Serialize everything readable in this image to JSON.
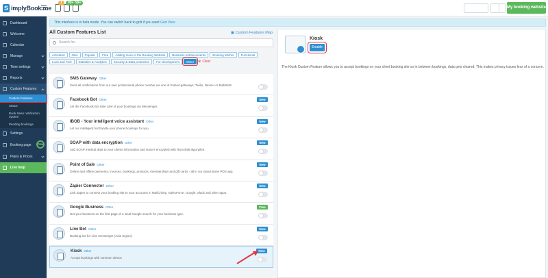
{
  "app": {
    "logo_mark": "S",
    "logo_text": "implyBook.me"
  },
  "topbar": {
    "badges": [
      "1",
      "99+",
      "99+"
    ],
    "user_label": "",
    "my_booking_label": "My booking website"
  },
  "sidebar": {
    "items": [
      {
        "label": "Dashboard",
        "icon": "dashboard-icon"
      },
      {
        "label": "Welcome",
        "icon": "welcome-icon"
      },
      {
        "label": "Calendar",
        "icon": "calendar-icon"
      },
      {
        "label": "Manage",
        "icon": "manage-icon"
      },
      {
        "label": "Time settings",
        "icon": "clock-icon"
      },
      {
        "label": "Reports",
        "icon": "reports-icon"
      },
      {
        "label": "Custom Features",
        "icon": "puzzle-icon"
      }
    ],
    "subitems": [
      "Custom Features",
      "Status",
      "Book Seen notification system",
      "Pending bookings"
    ],
    "items2": [
      {
        "label": "Settings",
        "icon": "gear-icon"
      },
      {
        "label": "Booking page",
        "icon": "booking-page-icon",
        "progress_label": "75%"
      },
      {
        "label": "Plans & Prices",
        "icon": "plans-icon"
      },
      {
        "label": "Live help",
        "icon": "help-icon"
      }
    ]
  },
  "banner": {
    "text": "This interface is in beta mode. You can switch back to grid if you want ",
    "link": "Grid View"
  },
  "list_panel": {
    "title": "All Custom Features List",
    "map_link": "Custom Features Map",
    "search_placeholder": "Search for...",
    "tags": [
      "Activated",
      "New",
      "Popular",
      "Free",
      "Adding more to the Booking Website",
      "Business enhancements",
      "Booking fetcher",
      "Functional",
      "Look and Feel",
      "Statistics & Analytics",
      "Security & Data protection",
      "For development",
      "Other"
    ],
    "selected_tag": "Other",
    "clear_label": "Clear",
    "features": [
      {
        "name": "SMS Gateway",
        "cat": "Other",
        "desc": "Send all notifications from our own professional phone number via one of trusted gateways: Twilio, Nexmo or BulkSMS.",
        "badge": ""
      },
      {
        "name": "Facebook Bot",
        "cat": "Other",
        "desc": "Let the Facebook Bot take care of your bookings via Messenger.",
        "badge": "New"
      },
      {
        "name": "IBOB - Your intelligent voice assistant",
        "cat": "Other",
        "desc": "Let our intelligent bot handle your phone bookings for you.",
        "badge": "New"
      },
      {
        "name": "SOAP with data encryption",
        "cat": "Other",
        "desc": "Add SOAP medical data to your clients information and store it encrypted with RSA4096 algorythm.",
        "badge": "New"
      },
      {
        "name": "Point of Sale",
        "cat": "Other",
        "desc": "Online and offline payments, invoices, bookings, products, memberships and gift cards - all in our stand alone POS app.",
        "badge": "New"
      },
      {
        "name": "Zapier Connector",
        "cat": "Other",
        "desc": "Link Zapier to connect your booking site to your accounts in MailChimp, SalesForce, Google, Slack and other apps.",
        "badge": "New"
      },
      {
        "name": "Google Business",
        "cat": "Other",
        "desc": "Get your business on the first page of a local Google search for your business type.",
        "badge": "Free"
      },
      {
        "name": "Line Bot",
        "cat": "Other",
        "desc": "Booking bot for Line messenger (Asia region).",
        "badge": "New"
      },
      {
        "name": "Kiosk",
        "cat": "Other",
        "desc": "Accept bookings with common device",
        "badge": "New"
      }
    ]
  },
  "detail": {
    "title": "Kiosk",
    "enable_label": "Enable",
    "description": "The Kiosk Custom Feature allows you to accept bookings on your client booking site so in between bookings, data gets cleared. This makes privacy issues less of a concern."
  }
}
